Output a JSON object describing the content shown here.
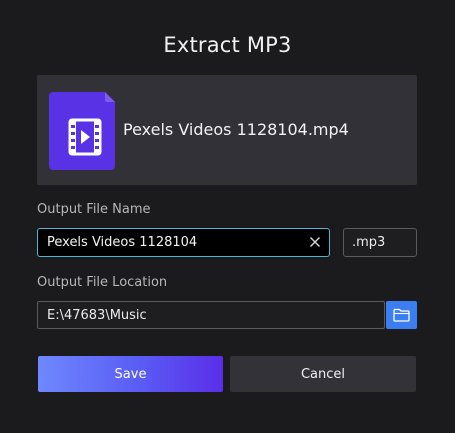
{
  "dialog": {
    "title": "Extract MP3"
  },
  "file": {
    "name": "Pexels Videos 1128104.mp4",
    "icon": "video-file-icon"
  },
  "output_name": {
    "label": "Output File Name",
    "value": "Pexels Videos 1128104",
    "extension": ".mp3",
    "clear_icon": "close-icon"
  },
  "output_location": {
    "label": "Output File Location",
    "value": "E:\\47683\\Music",
    "browse_icon": "folder-icon"
  },
  "buttons": {
    "save": "Save",
    "cancel": "Cancel"
  },
  "colors": {
    "background": "#1b1b1d",
    "card": "#323137",
    "focus_border": "#4eb6d0",
    "accent_blue": "#3b7ef2",
    "save_gradient_start": "#6e88ff",
    "save_gradient_end": "#5a2ee8",
    "file_icon": "#5a32e6"
  }
}
